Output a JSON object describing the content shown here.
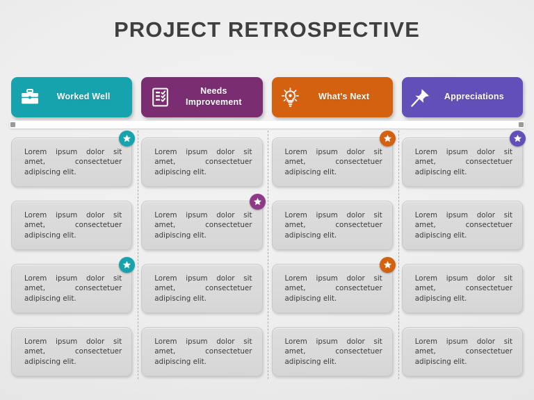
{
  "page": {
    "title": "PROJECT RETROSPECTIVE",
    "background_color": "#ececec"
  },
  "ruler": {
    "nub_color": "#9a9a9a",
    "bar_color": "#ffffff"
  },
  "columns": [
    {
      "label": "Worked Well",
      "icon": "briefcase-icon",
      "color": "#16a3ae",
      "badge_color": "#16a3ae"
    },
    {
      "label": "Needs\nImprovement",
      "label_line1": "Needs",
      "label_line2": "Improvement",
      "icon": "checklist-icon",
      "color": "#7b2d72",
      "badge_color": "#8e3a86"
    },
    {
      "label": "What's Next",
      "icon": "lightbulb-icon",
      "color": "#d4610f",
      "badge_color": "#d4610f"
    },
    {
      "label": "Appreciations",
      "icon": "pushpin-icon",
      "color": "#6250b8",
      "badge_color": "#6250b8"
    }
  ],
  "card_text": "Lorem ipsum dolor sit amet, consectetuer adipiscing elit.",
  "cards": [
    [
      {
        "text": "Lorem ipsum dolor sit amet, consectetuer adipiscing elit.",
        "badge": true,
        "badge_color": "#16a3ae"
      },
      {
        "text": "Lorem ipsum dolor sit amet, consectetuer adipiscing elit.",
        "badge": false,
        "badge_color": "#8e3a86"
      },
      {
        "text": "Lorem ipsum dolor sit amet, consectetuer adipiscing elit.",
        "badge": true,
        "badge_color": "#d4610f"
      },
      {
        "text": "Lorem ipsum dolor sit amet, consectetuer adipiscing elit.",
        "badge": true,
        "badge_color": "#6250b8"
      }
    ],
    [
      {
        "text": "Lorem ipsum dolor sit amet, consectetuer adipiscing elit.",
        "badge": false,
        "badge_color": "#16a3ae"
      },
      {
        "text": "Lorem ipsum dolor sit amet, consectetuer adipiscing elit.",
        "badge": true,
        "badge_color": "#8e3a86"
      },
      {
        "text": "Lorem ipsum dolor sit amet, consectetuer adipiscing elit.",
        "badge": false,
        "badge_color": "#d4610f"
      },
      {
        "text": "Lorem ipsum dolor sit amet, consectetuer adipiscing elit.",
        "badge": false,
        "badge_color": "#6250b8"
      }
    ],
    [
      {
        "text": "Lorem ipsum dolor sit amet, consectetuer adipiscing elit.",
        "badge": true,
        "badge_color": "#16a3ae"
      },
      {
        "text": "Lorem ipsum dolor sit amet, consectetuer adipiscing elit.",
        "badge": false,
        "badge_color": "#8e3a86"
      },
      {
        "text": "Lorem ipsum dolor sit amet, consectetuer adipiscing elit.",
        "badge": true,
        "badge_color": "#d4610f"
      },
      {
        "text": "Lorem ipsum dolor sit amet, consectetuer adipiscing elit.",
        "badge": false,
        "badge_color": "#6250b8"
      }
    ],
    [
      {
        "text": "Lorem ipsum dolor sit amet, consectetuer adipiscing elit.",
        "badge": false,
        "badge_color": "#16a3ae"
      },
      {
        "text": "Lorem ipsum dolor sit amet, consectetuer adipiscing elit.",
        "badge": false,
        "badge_color": "#8e3a86"
      },
      {
        "text": "Lorem ipsum dolor sit amet, consectetuer adipiscing elit.",
        "badge": false,
        "badge_color": "#d4610f"
      },
      {
        "text": "Lorem ipsum dolor sit amet, consectetuer adipiscing elit.",
        "badge": false,
        "badge_color": "#6250b8"
      }
    ]
  ]
}
